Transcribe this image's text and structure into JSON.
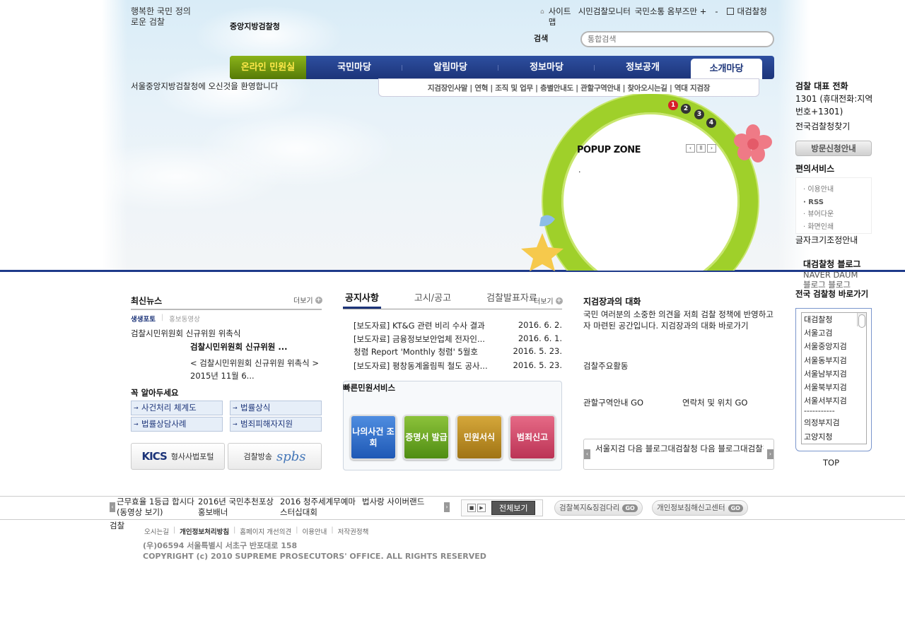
{
  "header": {
    "slogan": "행복한 국민 정의로운 검찰",
    "logo": "중앙지방검찰청",
    "top_links": {
      "sitemap": "사이트맵",
      "monitor": "시민검찰모니터",
      "ombudsman": "국민소통 옴부즈만 +",
      "dash": "-",
      "supreme": "대검찰청"
    },
    "search": {
      "label": "검색",
      "placeholder": "통합검색"
    }
  },
  "gnb": {
    "items": [
      "온라인 민원실",
      "국민마당",
      "알림마당",
      "정보마당",
      "정보공개",
      "소개마당"
    ]
  },
  "welcome": "서울중앙지방검찰청에 오신것을 환영합니다",
  "subnav": "지검장인사말 | 연혁 | 조직 및 업무 | 층별안내도 | 관할구역안내 | 찾아오시는길 | 역대 지검장",
  "popup": {
    "title": "POPUP ZONE",
    "dot": ".",
    "numbers": [
      "1",
      "2",
      "3",
      "4"
    ]
  },
  "right": {
    "phone_title": "검찰 대표 전화",
    "phone_desc": "1301 (휴대전화:지역번호+1301)",
    "find": "전국검찰청찾기",
    "visit_btn": "방문신청안내",
    "conv_title": "편의서비스",
    "conv_items": [
      "· 이용안내",
      "· RSS",
      "· 뷰어다운",
      "· 화면인쇄"
    ],
    "font_size": "글자크기조정안내",
    "blog_title": "대검찰청 블로그",
    "blog_links": "NAVER  DAUM 블로그   블로그",
    "region_title": "전국 검찰청 바로가기",
    "regions": [
      "대검찰청",
      "서울고검",
      "서울중앙지검",
      "서울동부지검",
      "서울남부지검",
      "서울북부지검",
      "서울서부지검",
      "-----------",
      "의정부지검",
      "고양지청"
    ],
    "top": "TOP"
  },
  "news": {
    "title": "최신뉴스",
    "more": "더보기",
    "tab_on": "생생포토",
    "tab_off": "홍보동영상",
    "item1": "검찰시민위원회 신규위원 위촉식",
    "item2_title": "검찰시민위원회 신규위원 ...",
    "item2_desc": "< 검찰시민위원회 신규위원 위촉식 > 2015년 11월 6..."
  },
  "must_know": {
    "title": "꼭 알아두세요",
    "links": [
      "사건처리 체계도",
      "법률상식",
      "법률상담사례",
      "범죄피해자지원"
    ]
  },
  "banners": {
    "kics_logo": "KICS",
    "kics": "형사사법포털",
    "spbs_label": "검찰방송",
    "spbs_logo": "spbs"
  },
  "notice": {
    "tabs": [
      "공지사항",
      "고시/공고",
      "검찰발표자료"
    ],
    "more": "더보기",
    "rows": [
      {
        "title": "[보도자료] KT&G 관련 비리 수사 결과",
        "date": "2016. 6. 2."
      },
      {
        "title": "[보도자료] 금융정보보안업체 전자인...",
        "date": "2016. 6. 1."
      },
      {
        "title": "청렴 Report 'Monthly 청렴' 5월호",
        "date": "2016. 5. 23."
      },
      {
        "title": "[보도자료] 평창동계올림픽 철도 공사...",
        "date": "2016. 5. 23."
      }
    ]
  },
  "quick": {
    "title": "빠른민원서비스",
    "buttons": [
      "나의사건 조회",
      "증명서 발급",
      "민원서식",
      "범죄신고"
    ]
  },
  "dialog": {
    "title": "지검장과의 대화",
    "desc": "국민 여러분의 소중한 의견을 저희 검찰 정책에 반영하고자 마련된 공간입니다. 지검장과의 대화 바로가기",
    "activities": "검찰주요활동",
    "jurisdiction": "관할구역안내 GO",
    "contact": "연락처 및 위치 GO",
    "blogbar": "서울지검 다음 블로그대검찰청 다음 블로그대검찰청"
  },
  "footer": {
    "banner1": "근무효율 1등급 합시다(동영상 보기)",
    "banner2": "2016년 국민추천포상 홍보배너",
    "banner3": "2016 청주세계무예마스터십대회",
    "banner4": "법사랑 사이버랜드",
    "view_all": "전체보기",
    "pill1": "검찰복지&징검다리",
    "pill2": "개인정보침해신고센터",
    "go": "GO",
    "left_label": "검찰",
    "links": [
      "오시는길",
      "개인정보처리방침",
      "홈페이지 개선의견",
      "이용안내",
      "저작권정책"
    ],
    "address": "(우)06594 서울특별시 서초구 반포대로 158",
    "copyright": "COPYRIGHT (c) 2010 SUPREME PROSECUTORS' OFFICE. ALL RIGHTS RESERVED"
  },
  "colors": {
    "navy": "#1c3479",
    "green": "#9fd02a",
    "online_yellow": "#ffe94a"
  }
}
